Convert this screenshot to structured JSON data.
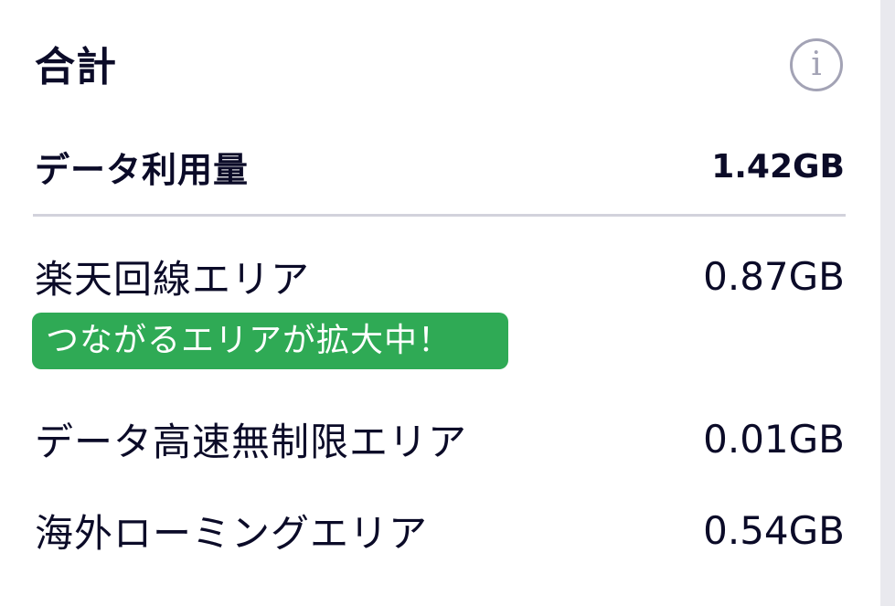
{
  "header": {
    "title": "合計",
    "info_icon_glyph": "i",
    "info_icon": "info-circle-icon"
  },
  "total": {
    "label": "データ利用量",
    "value": "1.42GB"
  },
  "areas": [
    {
      "label": "楽天回線エリア",
      "value": "0.87GB",
      "badge": "つながるエリアが拡大中！"
    },
    {
      "label": "データ高速無制限エリア",
      "value": "0.01GB"
    },
    {
      "label": "海外ローミングエリア",
      "value": "0.54GB"
    }
  ],
  "colors": {
    "text": "#0b0b28",
    "badge_bg": "#2faa55",
    "divider": "#d2d2dc",
    "icon": "#a3a3b5"
  }
}
